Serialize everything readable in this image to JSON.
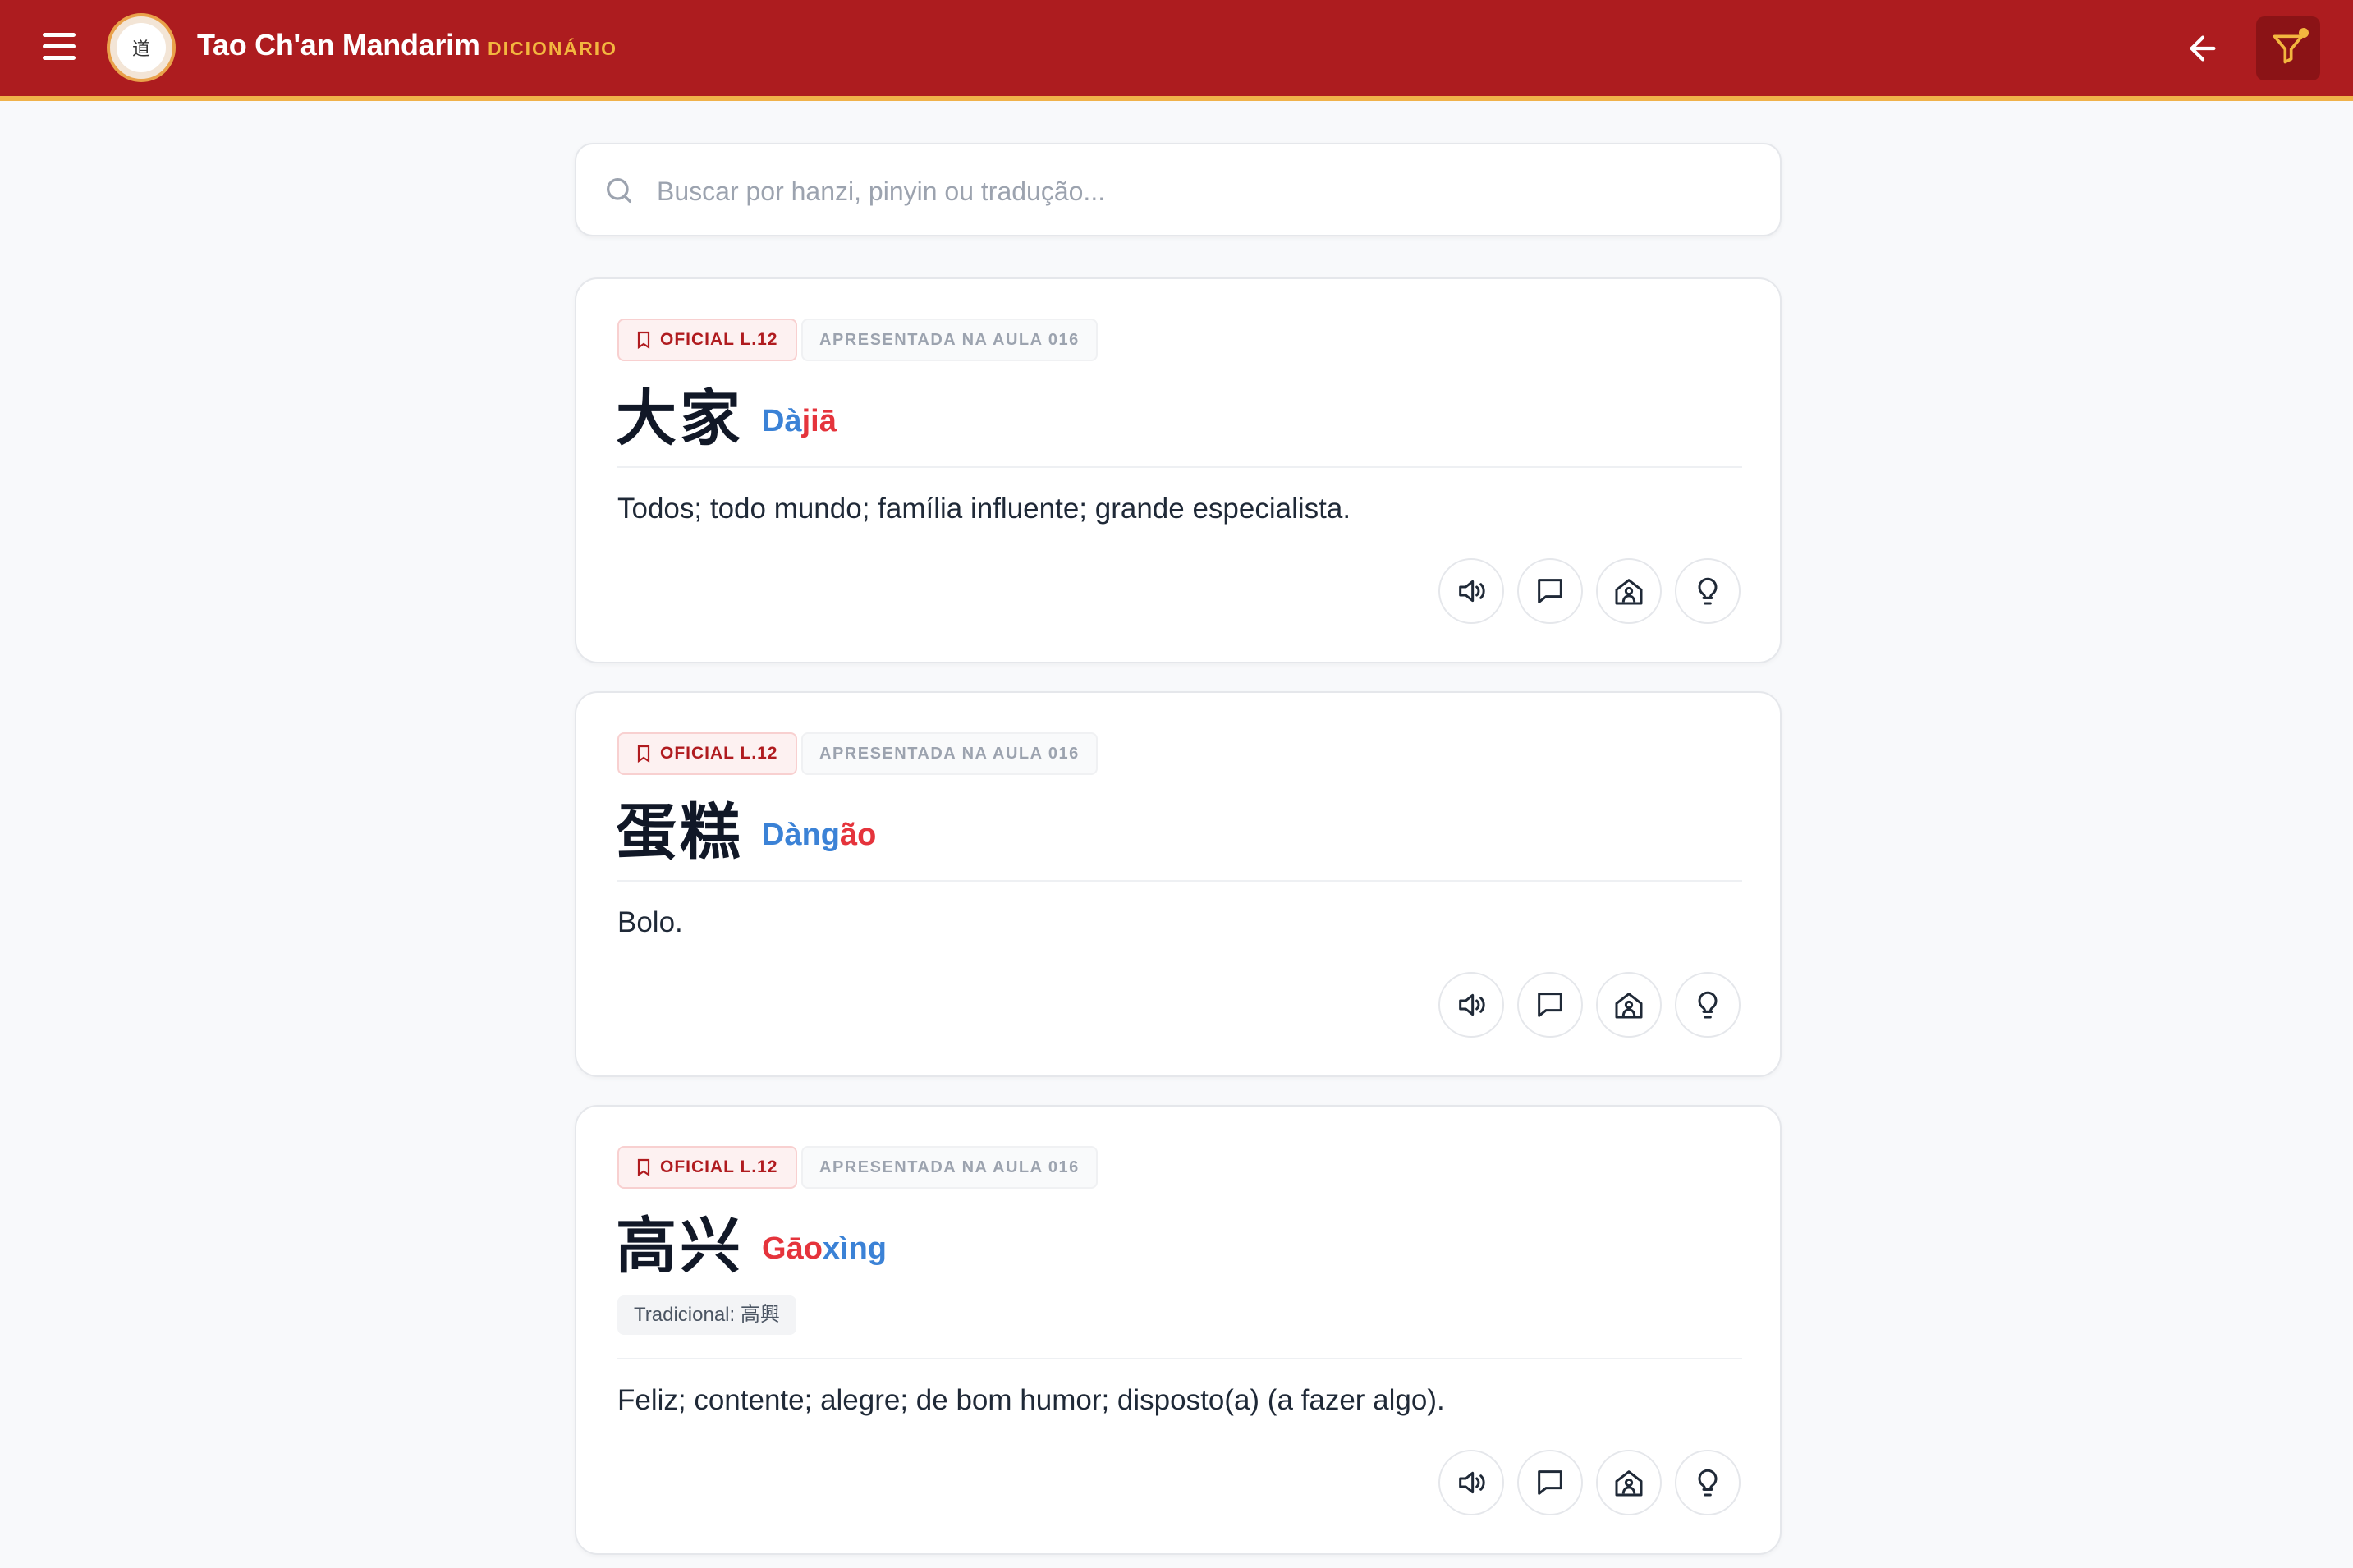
{
  "header": {
    "logo_text": "道",
    "title": "Tao Ch'an Mandarim",
    "section": "DICIONÁRIO",
    "colors": {
      "bar": "#ad1c1f",
      "accent": "#f0b24a"
    }
  },
  "search": {
    "placeholder": "Buscar por hanzi, pinyin ou tradução..."
  },
  "entries": [
    {
      "tag": "OFICIAL L.12",
      "lesson": "APRESENTADA NA AULA 016",
      "hanzi": "大家",
      "pinyin_parts": [
        "Dà",
        "jiā"
      ],
      "traditional": "",
      "meaning": "Todos; todo mundo; família influente; grande especialista."
    },
    {
      "tag": "OFICIAL L.12",
      "lesson": "APRESENTADA NA AULA 016",
      "hanzi": "蛋糕",
      "pinyin_parts": [
        "Dàng",
        "ão"
      ],
      "traditional": "",
      "meaning": "Bolo."
    },
    {
      "tag": "OFICIAL L.12",
      "lesson": "APRESENTADA NA AULA 016",
      "hanzi": "高兴",
      "pinyin_parts": [
        "Gāo",
        "xìng"
      ],
      "traditional": "Tradicional: 高興",
      "meaning": "Feliz; contente; alegre; de bom humor; disposto(a) (a fazer algo)."
    }
  ],
  "icons": [
    "menu-icon",
    "arrow-left-icon",
    "filter-icon",
    "search-icon",
    "bookmark-icon",
    "speaker-icon",
    "message-icon",
    "house-user-icon",
    "lightbulb-icon"
  ]
}
